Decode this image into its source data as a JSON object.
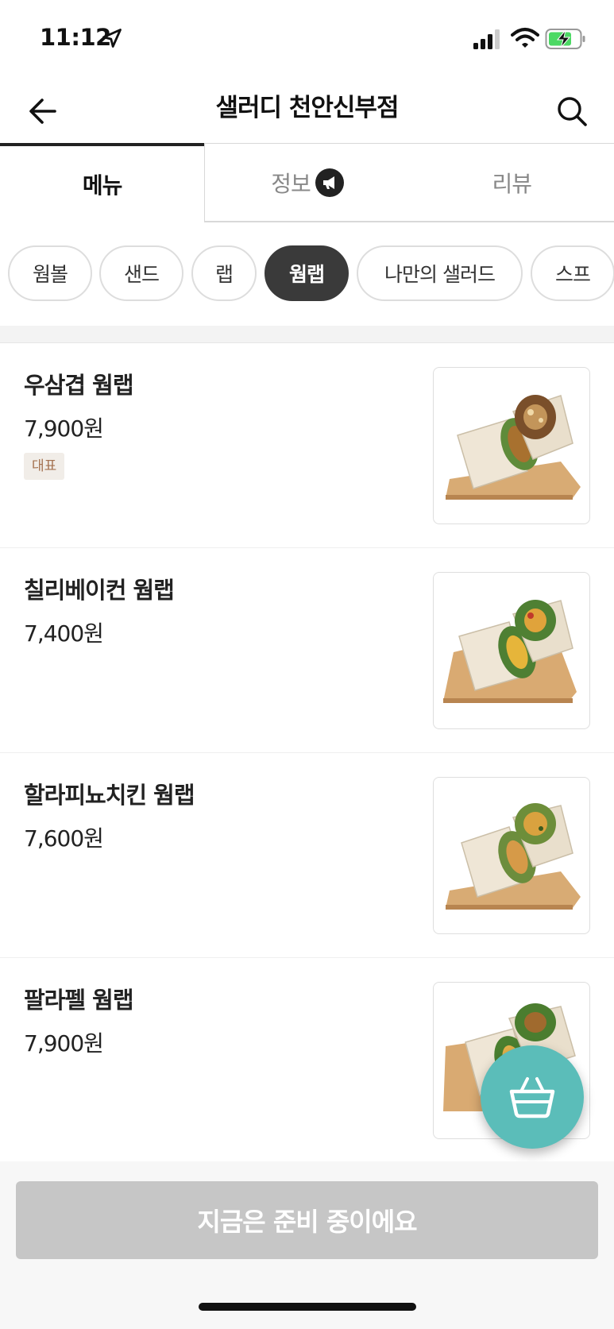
{
  "status_bar": {
    "time": "11:12"
  },
  "header": {
    "title": "샐러디 천안신부점"
  },
  "tabs": [
    {
      "label": "메뉴",
      "active": true
    },
    {
      "label": "정보",
      "active": false
    },
    {
      "label": "리뷰",
      "active": false
    }
  ],
  "categories": [
    {
      "label": "웜볼",
      "active": false
    },
    {
      "label": "샌드",
      "active": false
    },
    {
      "label": "랩",
      "active": false
    },
    {
      "label": "웜랩",
      "active": true
    },
    {
      "label": "나만의 샐러드",
      "active": false
    },
    {
      "label": "스프",
      "active": false
    }
  ],
  "menu_items": [
    {
      "name": "우삼겹 웜랩",
      "price": "7,900원",
      "badge": "대표"
    },
    {
      "name": "칠리베이컨 웜랩",
      "price": "7,400원"
    },
    {
      "name": "할라피뇨치킨 웜랩",
      "price": "7,600원"
    },
    {
      "name": "팔라펠 웜랩",
      "price": "7,900원"
    }
  ],
  "order_button": {
    "label": "지금은 준비 중이에요"
  },
  "colors": {
    "accent_teal": "#5bbdb9",
    "chip_active": "#3a3a3a",
    "badge_text": "#a4714f",
    "badge_bg": "#f1ede8",
    "disabled_button": "#c6c6c6"
  }
}
